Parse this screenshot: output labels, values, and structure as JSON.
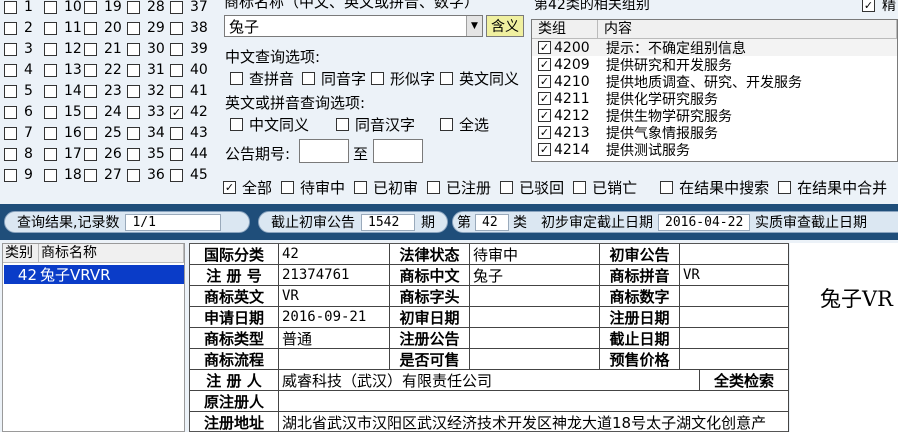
{
  "class_grid": {
    "columns": [
      [
        {
          "n": "1",
          "c": false
        },
        {
          "n": "2",
          "c": false
        },
        {
          "n": "3",
          "c": false
        },
        {
          "n": "4",
          "c": false
        },
        {
          "n": "5",
          "c": false
        },
        {
          "n": "6",
          "c": false
        },
        {
          "n": "7",
          "c": false
        },
        {
          "n": "8",
          "c": false
        },
        {
          "n": "9",
          "c": false
        }
      ],
      [
        {
          "n": "10",
          "c": false
        },
        {
          "n": "11",
          "c": false
        },
        {
          "n": "12",
          "c": false
        },
        {
          "n": "13",
          "c": false
        },
        {
          "n": "14",
          "c": false
        },
        {
          "n": "15",
          "c": false
        },
        {
          "n": "16",
          "c": false
        },
        {
          "n": "17",
          "c": false
        },
        {
          "n": "18",
          "c": false
        }
      ],
      [
        {
          "n": "19",
          "c": false
        },
        {
          "n": "20",
          "c": false
        },
        {
          "n": "21",
          "c": false
        },
        {
          "n": "22",
          "c": false
        },
        {
          "n": "23",
          "c": false
        },
        {
          "n": "24",
          "c": false
        },
        {
          "n": "25",
          "c": false
        },
        {
          "n": "26",
          "c": false
        },
        {
          "n": "27",
          "c": false
        }
      ],
      [
        {
          "n": "28",
          "c": false
        },
        {
          "n": "29",
          "c": false
        },
        {
          "n": "30",
          "c": false
        },
        {
          "n": "31",
          "c": false
        },
        {
          "n": "32",
          "c": false
        },
        {
          "n": "33",
          "c": false
        },
        {
          "n": "34",
          "c": false
        },
        {
          "n": "35",
          "c": false
        },
        {
          "n": "36",
          "c": false
        }
      ],
      [
        {
          "n": "37",
          "c": false
        },
        {
          "n": "38",
          "c": false
        },
        {
          "n": "39",
          "c": false
        },
        {
          "n": "40",
          "c": false
        },
        {
          "n": "41",
          "c": false
        },
        {
          "n": "42",
          "c": true
        },
        {
          "n": "43",
          "c": false
        },
        {
          "n": "44",
          "c": false
        },
        {
          "n": "45",
          "c": false
        }
      ]
    ]
  },
  "query": {
    "name_label": "商标名称（中文、英文或拼音、数字）",
    "name_value": "兔子",
    "hanyi_button": "含义",
    "cn_options_label": "中文查询选项:",
    "cn_options": [
      {
        "label": "查拼音",
        "checked": false
      },
      {
        "label": "同音字",
        "checked": false
      },
      {
        "label": "形似字",
        "checked": false
      },
      {
        "label": "英文同义",
        "checked": false
      }
    ],
    "en_options_label": "英文或拼音查询选项:",
    "en_options": [
      {
        "label": "中文同义",
        "checked": false
      },
      {
        "label": "同音汉字",
        "checked": false
      },
      {
        "label": "全选",
        "checked": false
      }
    ],
    "period_label": "公告期号:",
    "period_to": "至"
  },
  "groups": {
    "title": "第42类的相关组别",
    "top_right_label": "精",
    "columns": [
      "类组",
      "内容"
    ],
    "rows": [
      {
        "code": "4200",
        "text": "提示：不确定组别信息",
        "checked": true
      },
      {
        "code": "4209",
        "text": "提供研究和开发服务",
        "checked": true
      },
      {
        "code": "4210",
        "text": "提供地质调查、研究、开发服务",
        "checked": true
      },
      {
        "code": "4211",
        "text": "提供化学研究服务",
        "checked": true
      },
      {
        "code": "4212",
        "text": "提供生物学研究服务",
        "checked": true
      },
      {
        "code": "4213",
        "text": "提供气象情报服务",
        "checked": true
      },
      {
        "code": "4214",
        "text": "提供测试服务",
        "checked": true
      }
    ]
  },
  "filters": [
    {
      "label": "全部",
      "checked": true
    },
    {
      "label": "待审中",
      "checked": false
    },
    {
      "label": "已初审",
      "checked": false
    },
    {
      "label": "已注册",
      "checked": false
    },
    {
      "label": "已驳回",
      "checked": false
    },
    {
      "label": "已销亡",
      "checked": false
    },
    {
      "label": "在结果中搜索",
      "checked": false
    },
    {
      "label": "在结果中合并",
      "checked": false
    }
  ],
  "status": {
    "result_label": "查询结果,记录数",
    "result_count": "1/1",
    "cutoff_label": "截止初审公告",
    "cutoff_value": "1542",
    "cutoff_unit": "期",
    "class_prefix": "第",
    "class_value": "42",
    "class_suffix": "类",
    "prelim_label": "初步审定截止日期",
    "prelim_date": "2016-04-22",
    "real_label": "实质审查截止日期"
  },
  "results": {
    "columns": [
      "类别",
      "商标名称"
    ],
    "rows": [
      {
        "cls": "42",
        "name": "兔子VRVR"
      }
    ]
  },
  "detail": {
    "l_intl_class": "国际分类",
    "v_intl_class": "42",
    "l_legal": "法律状态",
    "v_legal": "待审中",
    "l_first_pub": "初审公告",
    "v_first_pub": "",
    "l_reg_no": "注 册 号",
    "v_reg_no": "21374761",
    "l_cn": "商标中文",
    "v_cn": "兔子",
    "l_pinyin": "商标拼音",
    "v_pinyin": "VR",
    "l_en": "商标英文",
    "v_en": "VR",
    "l_head": "商标字头",
    "v_head": "",
    "l_digit": "商标数字",
    "v_digit": "",
    "l_apply": "申请日期",
    "v_apply": "2016-09-21",
    "l_first_date": "初审日期",
    "v_first_date": "",
    "l_reg_date": "注册日期",
    "v_reg_date": "",
    "l_type": "商标类型",
    "v_type": "普通",
    "l_reg_pub": "注册公告",
    "v_reg_pub": "",
    "l_expire": "截止日期",
    "v_expire": "",
    "l_flow": "商标流程",
    "v_flow": "",
    "l_sale": "是否可售",
    "v_sale": "",
    "l_price": "预售价格",
    "v_price": "",
    "l_registrant": "注 册 人",
    "v_registrant": "威睿科技（武汉）有限责任公司",
    "l_all_search": "全类检索",
    "l_orig": "原注册人",
    "v_orig": "",
    "l_addr": "注册地址",
    "v_addr": "湖北省武汉市汉阳区武汉经济技术开发区神龙大道18号太子湖文化创意产"
  },
  "preview": {
    "text": "兔子VR"
  }
}
